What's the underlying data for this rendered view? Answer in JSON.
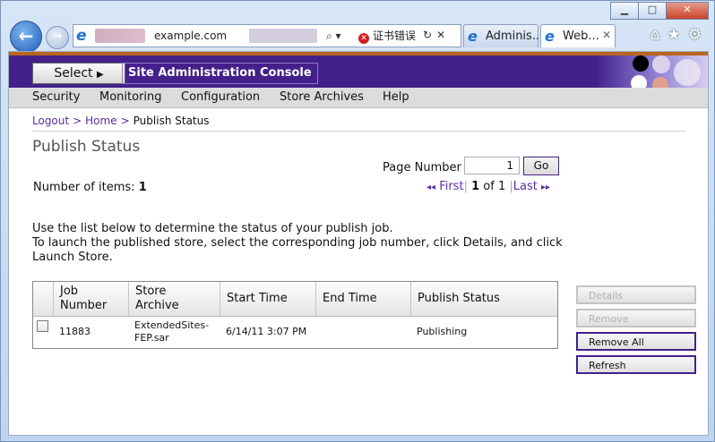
{
  "browser": {
    "address": {
      "url": "example.com",
      "cert_error": "证书错误"
    },
    "tabs": [
      {
        "label": "Adminis..."
      },
      {
        "label": "Web..."
      }
    ]
  },
  "banner": {
    "select_label": "Select",
    "title": "Site Administration Console"
  },
  "menu": {
    "items": [
      "Security",
      "Monitoring",
      "Configuration",
      "Store Archives",
      "Help"
    ]
  },
  "breadcrumb": {
    "logout": "Logout",
    "home": "Home",
    "current": "Publish Status"
  },
  "page": {
    "title": "Publish Status",
    "page_number_label": "Page Number",
    "page_number_value": "1",
    "go_label": "Go",
    "items_label": "Number of items:",
    "items_count": "1",
    "pager": {
      "first": "First",
      "current": "1",
      "of": "of",
      "total": "1",
      "last": "Last"
    },
    "instructions_1": "Use the list below to determine the status of your publish job.",
    "instructions_2": "To launch the published store, select the corresponding job number, click Details, and click Launch Store."
  },
  "table": {
    "headers": [
      "Job Number",
      "Store Archive",
      "Start Time",
      "End Time",
      "Publish Status"
    ],
    "rows": [
      {
        "job_number": "11883",
        "store_archive": "ExtendedSites-FEP.sar",
        "start_time": "6/14/11 3:07 PM",
        "end_time": "",
        "publish_status": "Publishing"
      }
    ]
  },
  "actions": {
    "details": "Details",
    "remove": "Remove",
    "remove_all": "Remove All",
    "refresh": "Refresh"
  },
  "colors": {
    "banner": "#43208a",
    "link": "#5b2fa6",
    "accent_strip": "#b8661d"
  }
}
